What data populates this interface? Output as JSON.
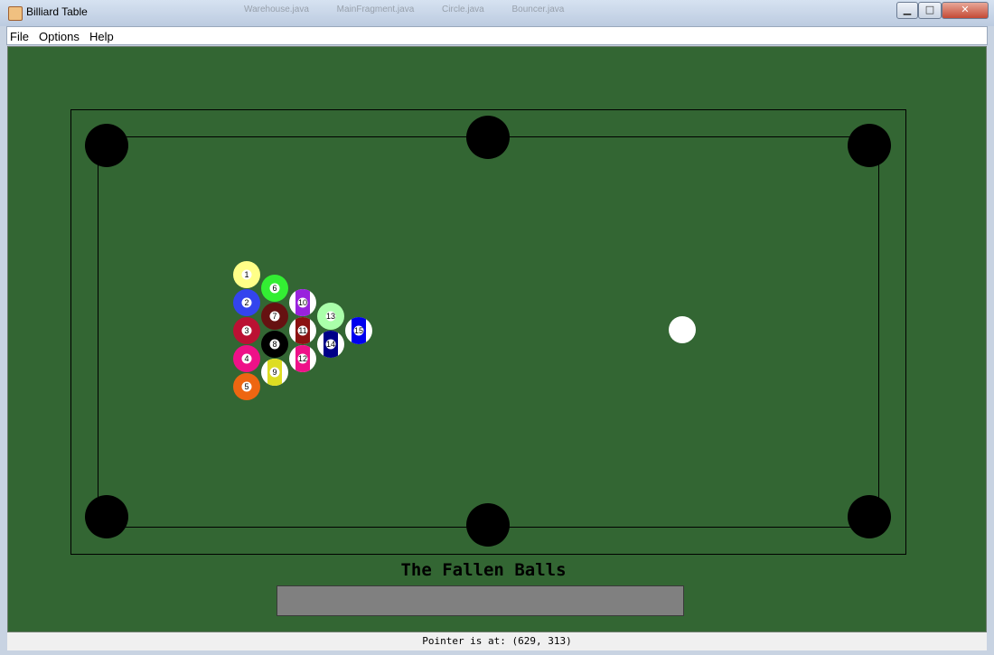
{
  "window": {
    "title": "Billiard Table",
    "taskbar_hints": [
      "Warehouse.java",
      "MainFragment.java",
      "Circle.java",
      "Bouncer.java"
    ],
    "buttons": {
      "minimize": "▁",
      "maximize": "□",
      "close": "✕"
    }
  },
  "menu": {
    "items": [
      "File",
      "Options",
      "Help"
    ]
  },
  "colors": {
    "felt": "#336633",
    "pocket": "#000000",
    "cue": "#ffffff",
    "bin": "#808080"
  },
  "balls": [
    {
      "number": "1",
      "color": "#ffff88",
      "striped": false
    },
    {
      "number": "2",
      "color": "#3344ee",
      "striped": false
    },
    {
      "number": "3",
      "color": "#bb1133",
      "striped": false
    },
    {
      "number": "4",
      "color": "#ee1188",
      "striped": false
    },
    {
      "number": "5",
      "color": "#ee6611",
      "striped": false
    },
    {
      "number": "6",
      "color": "#33ee33",
      "striped": false
    },
    {
      "number": "7",
      "color": "#661111",
      "striped": false
    },
    {
      "number": "8",
      "color": "#000000",
      "striped": false
    },
    {
      "number": "9",
      "color": "#dddd22",
      "striped": true
    },
    {
      "number": "10",
      "color": "#9922dd",
      "striped": true
    },
    {
      "number": "11",
      "color": "#8b1111",
      "striped": true
    },
    {
      "number": "12",
      "color": "#ee1188",
      "striped": true
    },
    {
      "number": "13",
      "color": "#aaffaa",
      "striped": false
    },
    {
      "number": "14",
      "color": "#000088",
      "striped": true
    },
    {
      "number": "15",
      "color": "#0000ee",
      "striped": true
    }
  ],
  "fallen": {
    "title": "The Fallen Balls"
  },
  "status": {
    "text": "Pointer is at:  (629, 313)"
  }
}
